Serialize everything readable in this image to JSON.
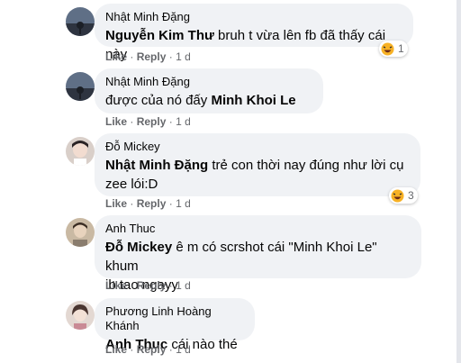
{
  "actions": {
    "like": "Like",
    "reply": "Reply",
    "sep": "·"
  },
  "comments": [
    {
      "author": "Nhật Minh Đặng",
      "mention": "Nguyễn Kim Thư",
      "text": " bruh t vừa lên fb đã thấy cái này",
      "time": "1 d",
      "reaction": {
        "icon": "haha-emoji-icon",
        "count": "1"
      }
    },
    {
      "author": "Nhật Minh Đặng",
      "mention": "",
      "text": "được của nó đấy ",
      "mention_after": "Minh Khoi Le",
      "time": "1 d"
    },
    {
      "author": "Đỗ Mickey",
      "mention": "Nhật Minh Đặng",
      "text": " trẻ con thời nay đúng như lời cụ",
      "text2": "zee lói:D",
      "time": "1 d",
      "reaction": {
        "icon": "haha-emoji-icon",
        "count": "3"
      }
    },
    {
      "author": "Anh Thuc",
      "mention": "Đỗ Mickey",
      "text": " ê m có scrshot cái \"Minh Khoi Le\" khum",
      "text2": "ib tao ngayy",
      "time": "1 d"
    },
    {
      "author": "Phương Linh Hoàng Khánh",
      "mention": "Anh Thuc",
      "text": " cái nào thé",
      "time": "1 d"
    }
  ],
  "colors": {
    "bubble": "#f0f2f5",
    "meta": "#65676b",
    "text": "#050505"
  }
}
